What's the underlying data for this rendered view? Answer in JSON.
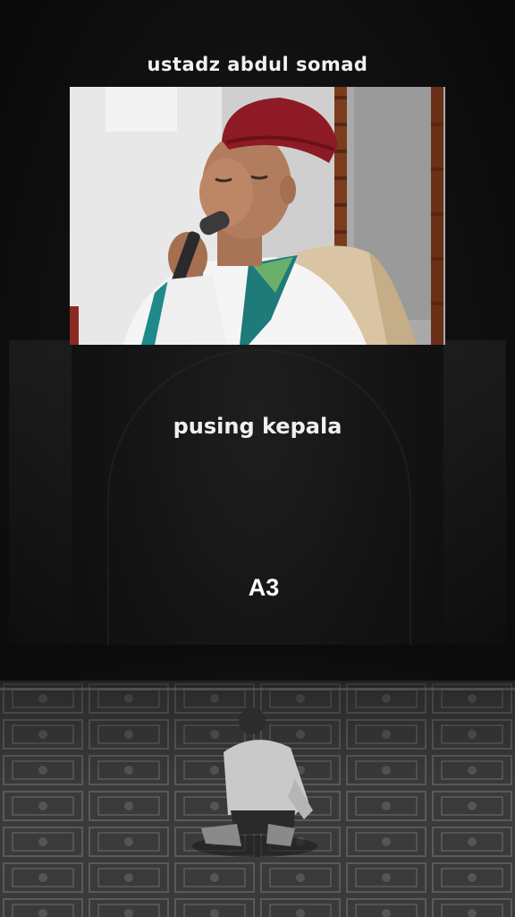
{
  "header": {
    "title": "ustadz abdul somad"
  },
  "video": {
    "description_icon": "preacher-with-microphone-video"
  },
  "caption": {
    "text": "pusing kepala"
  },
  "overlay": {
    "label": "A3"
  },
  "scene": {
    "icon": "man-praying-on-carpet"
  },
  "colors": {
    "background": "#0b0b0b",
    "text": "#f2f2f2",
    "cap": "#8e1a26",
    "scarf": "#1f8a8a"
  }
}
